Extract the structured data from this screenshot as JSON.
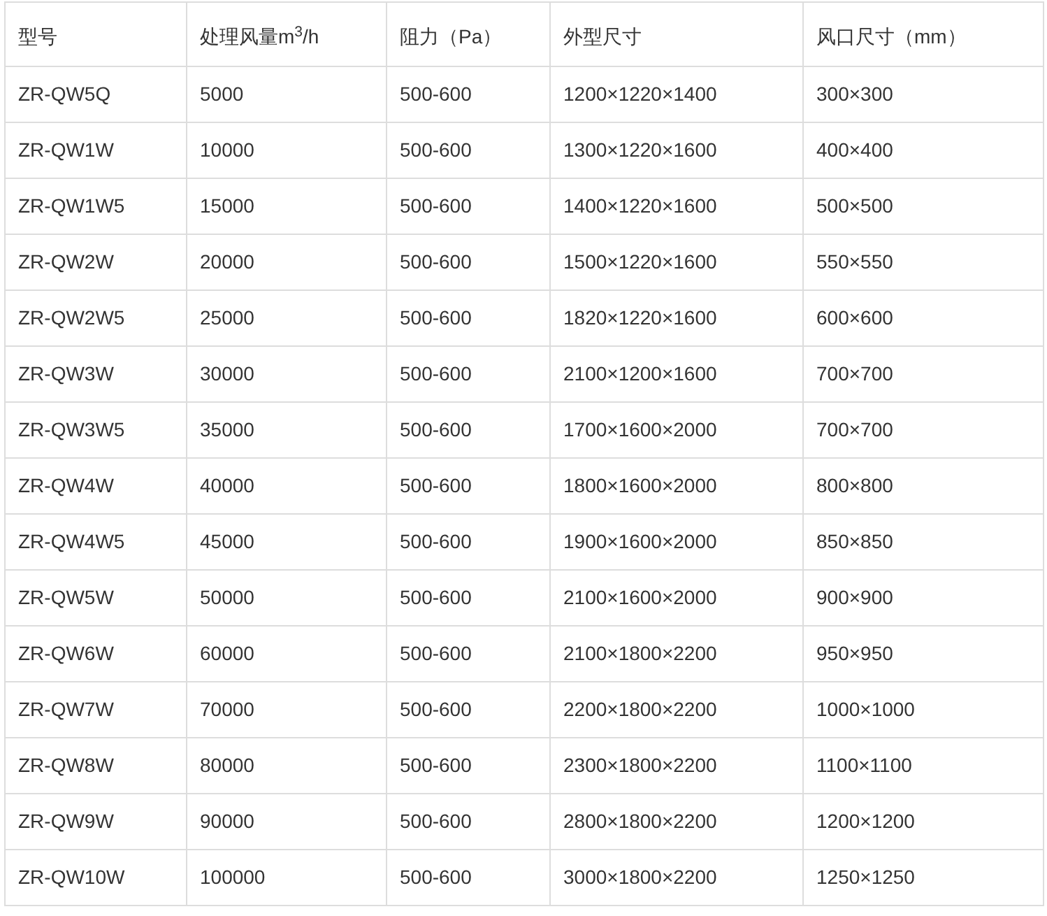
{
  "table": {
    "columns": [
      "型号",
      "处理风量m$^{3}$/h",
      "阻力（Pa）",
      "外型尺寸",
      "风口尺寸（mm）"
    ],
    "rows": [
      [
        "ZR-QW5Q",
        "5000",
        "500-600",
        "1200×1220×1400",
        "300×300"
      ],
      [
        "ZR-QW1W",
        "10000",
        "500-600",
        "1300×1220×1600",
        "400×400"
      ],
      [
        "ZR-QW1W5",
        "15000",
        "500-600",
        "1400×1220×1600",
        "500×500"
      ],
      [
        "ZR-QW2W",
        "20000",
        "500-600",
        "1500×1220×1600",
        "550×550"
      ],
      [
        "ZR-QW2W5",
        "25000",
        "500-600",
        "1820×1220×1600",
        "600×600"
      ],
      [
        "ZR-QW3W",
        "30000",
        "500-600",
        "2100×1200×1600",
        "700×700"
      ],
      [
        "ZR-QW3W5",
        "35000",
        "500-600",
        "1700×1600×2000",
        "700×700"
      ],
      [
        "ZR-QW4W",
        "40000",
        "500-600",
        "1800×1600×2000",
        "800×800"
      ],
      [
        "ZR-QW4W5",
        "45000",
        "500-600",
        "1900×1600×2000",
        "850×850"
      ],
      [
        "ZR-QW5W",
        "50000",
        "500-600",
        "2100×1600×2000",
        "900×900"
      ],
      [
        "ZR-QW6W",
        "60000",
        "500-600",
        "2100×1800×2200",
        "950×950"
      ],
      [
        "ZR-QW7W",
        "70000",
        "500-600",
        "2200×1800×2200",
        "1000×1000"
      ],
      [
        "ZR-QW8W",
        "80000",
        "500-600",
        "2300×1800×2200",
        "1100×1100"
      ],
      [
        "ZR-QW9W",
        "90000",
        "500-600",
        "2800×1800×2200",
        "1200×1200"
      ],
      [
        "ZR-QW10W",
        "100000",
        "500-600",
        "3000×1800×2200",
        "1250×1250"
      ]
    ]
  }
}
